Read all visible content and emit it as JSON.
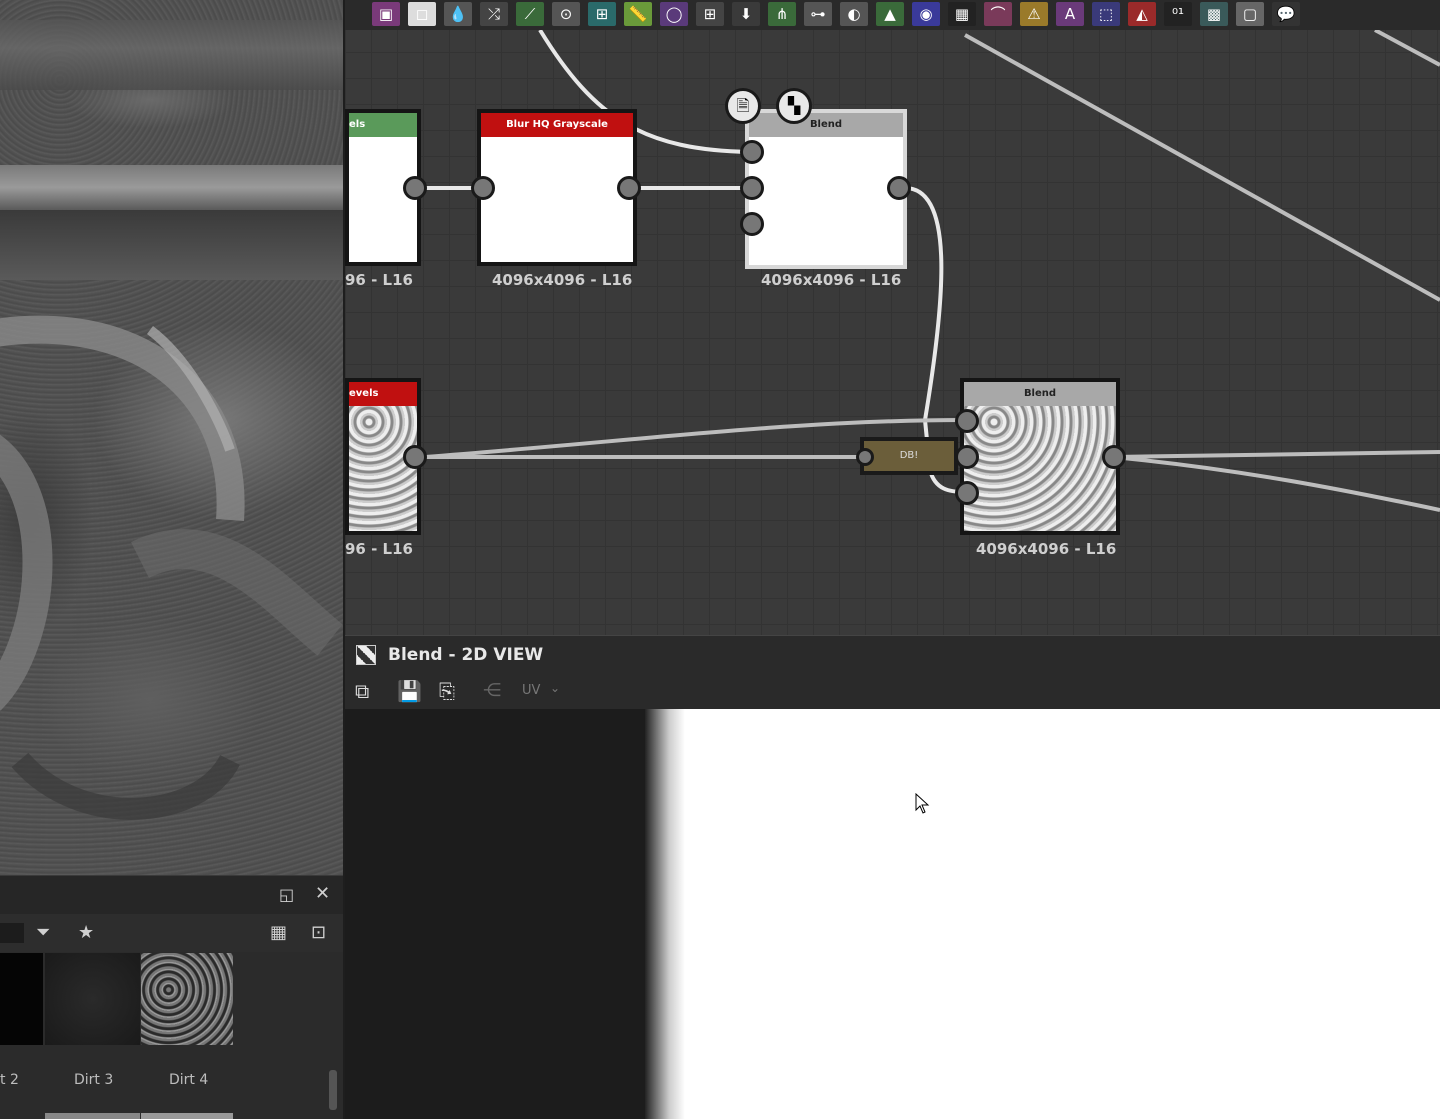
{
  "graph": {
    "nodes": [
      {
        "id": "levels-a",
        "title": "els",
        "title_color": "#5a9a5a",
        "resolution": "96 - L16"
      },
      {
        "id": "blur",
        "title": "Blur HQ Grayscale",
        "title_color": "#c01010",
        "resolution": "4096x4096 - L16"
      },
      {
        "id": "blend-a",
        "title": "Blend",
        "title_color": "#a8a8a8",
        "resolution": "4096x4096 - L16"
      },
      {
        "id": "levels-b",
        "title": "evels",
        "title_color": "#c01010",
        "resolution": "96 - L16"
      },
      {
        "id": "blend-b",
        "title": "Blend",
        "title_color": "#a8a8a8",
        "resolution": "4096x4096 - L16"
      }
    ],
    "dot_label": "DB!",
    "dot_color": "#6b5e3a"
  },
  "view2d": {
    "title": "Blend - 2D VIEW",
    "uv_label": "UV"
  },
  "library": {
    "thumbnails": [
      "t 2",
      "Dirt 3",
      "Dirt 4"
    ]
  },
  "toolbar": {
    "icons": [
      "image-icon",
      "uniform-color-icon",
      "drop-icon",
      "shuffle-icon",
      "curve-icon",
      "gradient-icon",
      "warp-icon",
      "ruler-icon",
      "circle-icon",
      "grid-icon",
      "import-icon",
      "tree-icon",
      "slider-icon",
      "mask-icon",
      "histogram-icon",
      "color-wheel-icon",
      "noise-icon",
      "spline-icon",
      "mirror-icon",
      "text-icon",
      "transform-icon",
      "fill-icon",
      "value-icon",
      "pattern-icon",
      "frame-icon",
      "comment-icon"
    ]
  }
}
